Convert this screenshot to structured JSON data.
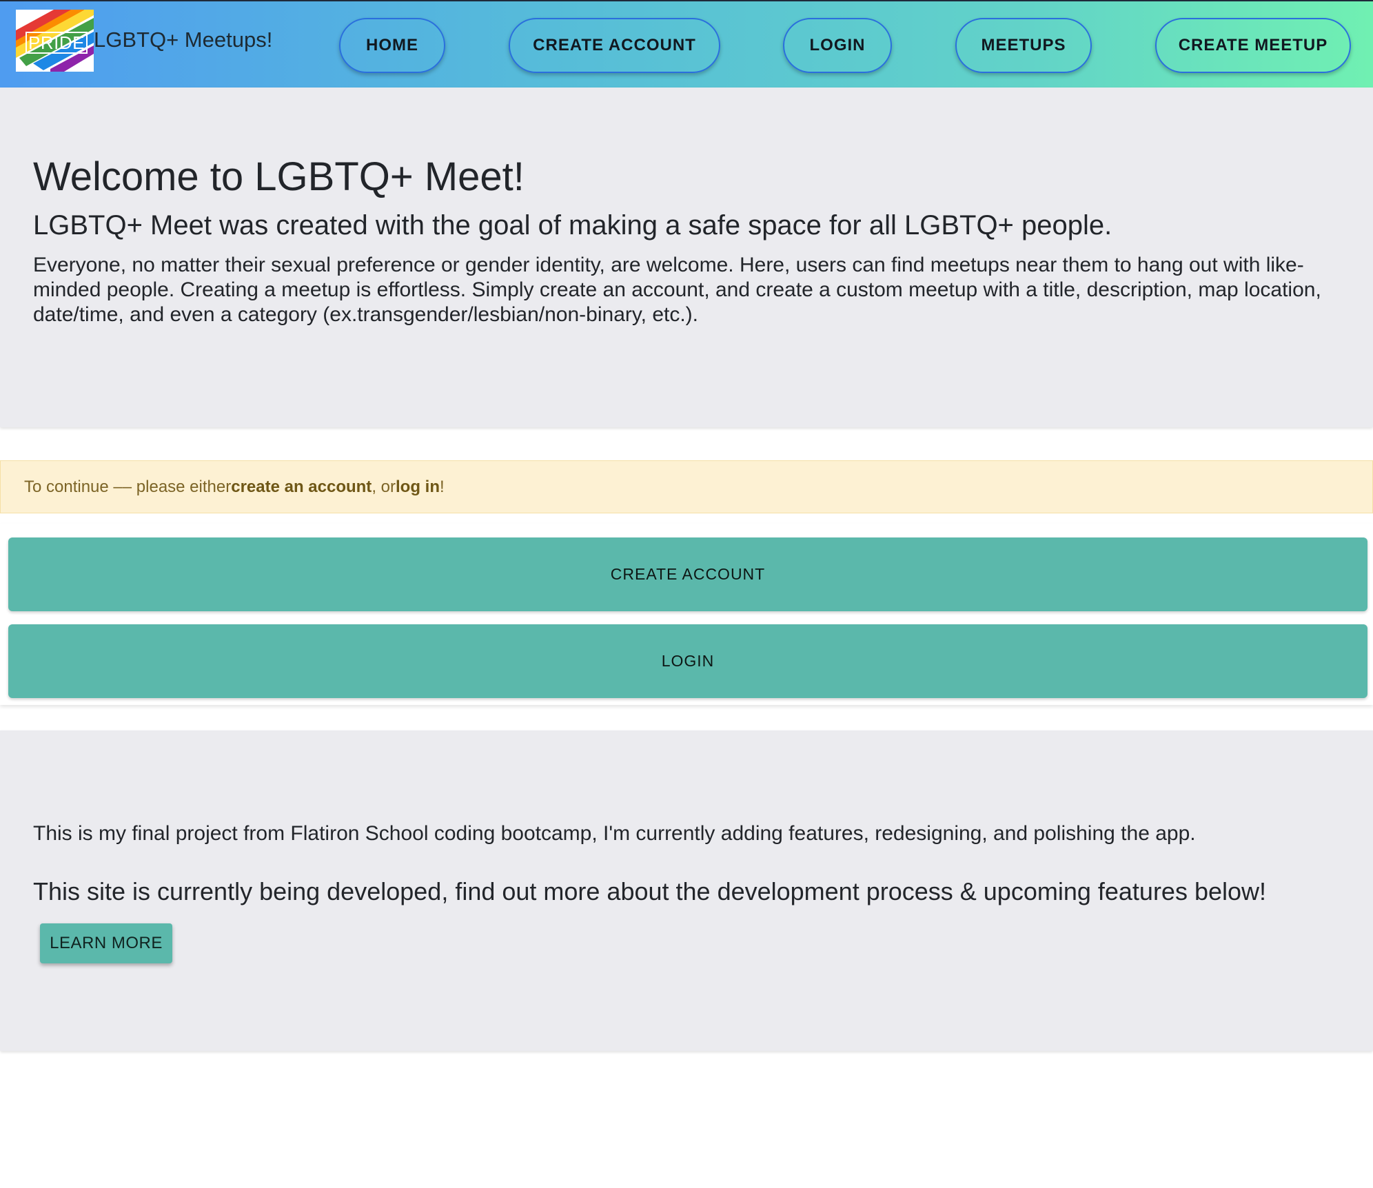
{
  "navbar": {
    "logo_text": "PRIDE",
    "brand_name": "LGBTQ+ Meetups!",
    "links": {
      "home": "HOME",
      "create_account": "CREATE ACCOUNT",
      "login": "LOGIN",
      "meetups": "MEETUPS",
      "create_meetup": "CREATE MEETUP"
    },
    "gradient_colors": [
      "#4f9cf0",
      "#70f0b2"
    ],
    "button_border_color": "#2a6fdd"
  },
  "welcome": {
    "title": "Welcome to LGBTQ+ Meet!",
    "subtitle": "LGBTQ+ Meet was created with the goal of making a safe space for all LGBTQ+ people.",
    "body": "Everyone, no matter their sexual preference or gender identity, are welcome. Here, users can find meetups near them to hang out with like-minded people. Creating a meetup is effortless. Simply create an account, and create a custom meetup with a title, description, map location, date/time, and even a category (ex.transgender/lesbian/non-binary, etc.)."
  },
  "alert": {
    "prefix": "To continue –– please either ",
    "create_link": "create an account",
    "middle": ", or ",
    "login_link": "log in",
    "suffix": "!",
    "background_color": "#fdf1d3"
  },
  "actions": {
    "create_account": "CREATE ACCOUNT",
    "login": "LOGIN",
    "button_color": "#5bb8ab"
  },
  "info": {
    "paragraph": "This is my final project from Flatiron School coding bootcamp, I'm currently adding features, redesigning, and polishing the app.",
    "heading": "This site is currently being developed, find out more about the development process & upcoming features below!",
    "learn_more": "LEARN MORE"
  }
}
